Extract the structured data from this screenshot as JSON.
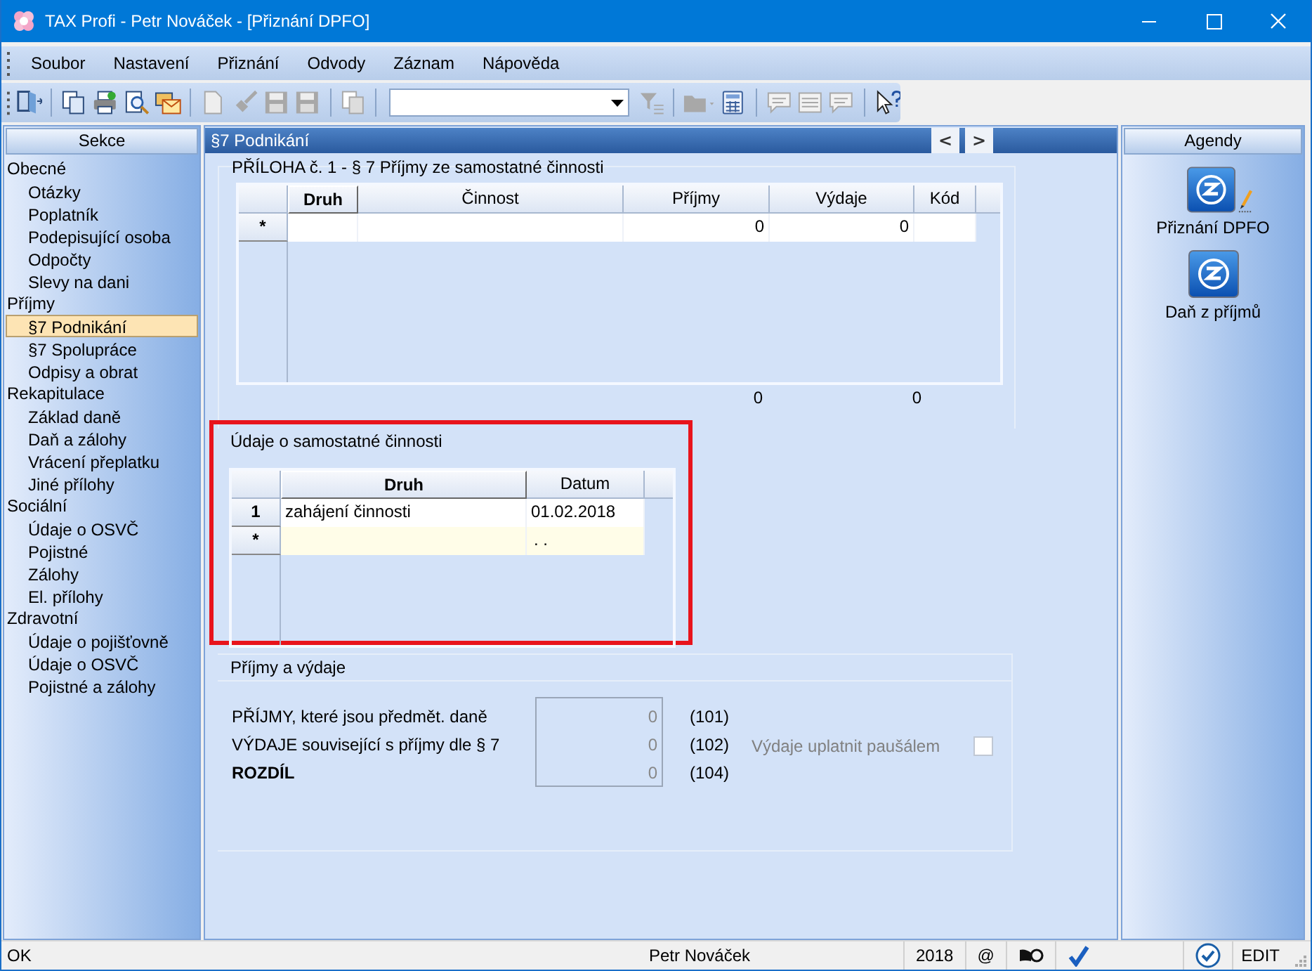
{
  "window": {
    "title": "TAX Profi - Petr Nováček - [Přiznání DPFO]"
  },
  "menu": [
    {
      "label": "Soubor"
    },
    {
      "label": "Nastavení"
    },
    {
      "label": "Přiznání"
    },
    {
      "label": "Odvody"
    },
    {
      "label": "Záznam"
    },
    {
      "label": "Nápověda"
    }
  ],
  "toolbar": [
    {
      "kind": "exit",
      "disabled": false
    },
    {
      "kind": "separator"
    },
    {
      "kind": "copy",
      "disabled": false
    },
    {
      "kind": "print",
      "disabled": false
    },
    {
      "kind": "preview",
      "disabled": false
    },
    {
      "kind": "mail",
      "disabled": false
    },
    {
      "kind": "separator"
    },
    {
      "kind": "page",
      "disabled": true
    },
    {
      "kind": "brush",
      "disabled": true
    },
    {
      "kind": "save",
      "disabled": true
    },
    {
      "kind": "save",
      "disabled": true
    },
    {
      "kind": "separator"
    },
    {
      "kind": "copy",
      "disabled": true
    },
    {
      "kind": "separator"
    },
    {
      "kind": "combo"
    },
    {
      "kind": "filter",
      "disabled": true
    },
    {
      "kind": "separator"
    },
    {
      "kind": "folder",
      "disabled": true
    },
    {
      "kind": "calculator",
      "disabled": false
    },
    {
      "kind": "separator"
    },
    {
      "kind": "comment",
      "disabled": true
    },
    {
      "kind": "list",
      "disabled": true
    },
    {
      "kind": "comment",
      "disabled": true
    },
    {
      "kind": "separator"
    },
    {
      "kind": "help",
      "disabled": false
    }
  ],
  "sidebar": {
    "title": "Sekce",
    "items": [
      {
        "label": "Obecné",
        "children": [
          {
            "label": "Otázky",
            "selected": false
          },
          {
            "label": "Poplatník",
            "selected": false
          },
          {
            "label": "Podepisující osoba",
            "selected": false
          },
          {
            "label": "Odpočty",
            "selected": false
          },
          {
            "label": "Slevy na dani",
            "selected": false
          }
        ]
      },
      {
        "label": "Příjmy",
        "children": [
          {
            "label": "§7 Podnikání",
            "selected": true
          },
          {
            "label": "§7 Spolupráce",
            "selected": false
          },
          {
            "label": "Odpisy a obrat",
            "selected": false
          }
        ]
      },
      {
        "label": "Rekapitulace",
        "children": [
          {
            "label": "Základ daně",
            "selected": false
          },
          {
            "label": "Daň a zálohy",
            "selected": false
          },
          {
            "label": "Vrácení přeplatku",
            "selected": false
          },
          {
            "label": "Jiné přílohy",
            "selected": false
          }
        ]
      },
      {
        "label": "Sociální",
        "children": [
          {
            "label": "Údaje o OSVČ",
            "selected": false
          },
          {
            "label": "Pojistné",
            "selected": false
          },
          {
            "label": "Zálohy",
            "selected": false
          },
          {
            "label": "El. přílohy",
            "selected": false
          }
        ]
      },
      {
        "label": "Zdravotní",
        "children": [
          {
            "label": "Údaje o pojišťovně",
            "selected": false
          },
          {
            "label": "Údaje o OSVČ",
            "selected": false
          },
          {
            "label": "Pojistné a zálohy",
            "selected": false
          }
        ]
      }
    ]
  },
  "panel": {
    "title": "§7 Podnikání",
    "nav": [
      "<",
      ">"
    ]
  },
  "income_section": {
    "title": "PŘÍLOHA č. 1 - § 7 Příjmy ze samostatné činnosti",
    "columns": [
      "Druh",
      "Činnost",
      "Příjmy",
      "Výdaje",
      "Kód"
    ],
    "rows": [
      {
        "marker": "*",
        "new": false,
        "cells": [
          null,
          null,
          "0",
          "0",
          null
        ]
      }
    ],
    "totals": [
      "0",
      "0"
    ]
  },
  "activity_section": {
    "title": "Údaje o samostatné činnosti",
    "highlighted": true,
    "columns": [
      "Druh",
      "Datum"
    ],
    "rows": [
      {
        "marker": "1",
        "new": false,
        "cells": [
          "zahájení činnosti",
          "01.02.2018"
        ]
      },
      {
        "marker": "*",
        "new": true,
        "cells": [
          null,
          ". ."
        ]
      }
    ]
  },
  "summary_section": {
    "title": "Příjmy a výdaje",
    "rows": [
      {
        "label": "PŘÍJMY, které jsou předmět. daně",
        "bold": false,
        "value": "0",
        "code": "(101)"
      },
      {
        "label": "VÝDAJE související s příjmy dle § 7",
        "bold": false,
        "value": "0",
        "code": "(102)"
      },
      {
        "label": "ROZDÍL",
        "bold": true,
        "value": "0",
        "code": "(104)"
      }
    ],
    "flat_rate": {
      "label": "Výdaje uplatnit paušálem",
      "checked": false,
      "disabled": true
    }
  },
  "agendas": {
    "title": "Agendy",
    "items": [
      {
        "label": "Přiznání DPFO",
        "editing": true
      },
      {
        "label": "Daň z příjmů",
        "editing": false
      }
    ]
  },
  "status_bar": {
    "message": "OK",
    "user": "Petr Nováček",
    "year": "2018",
    "email": "@",
    "mode": "EDIT"
  }
}
